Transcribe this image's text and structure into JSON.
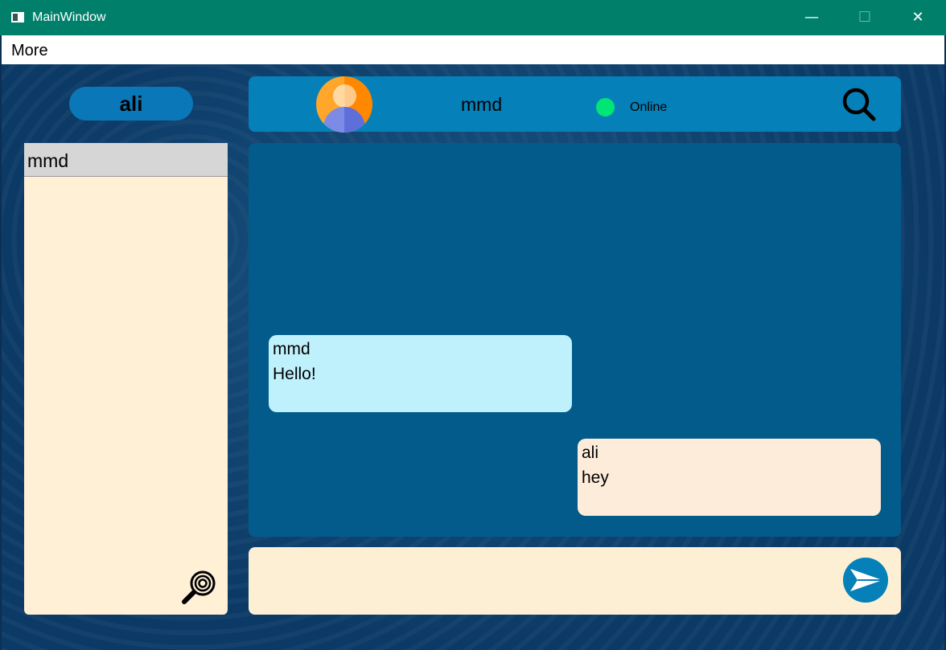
{
  "window": {
    "title": "MainWindow",
    "minimize_glyph": "—",
    "maximize_glyph": "☐",
    "close_glyph": "✕"
  },
  "menu": {
    "more_label": "More"
  },
  "current_user": {
    "name": "ali"
  },
  "chat_header": {
    "contact_name": "mmd",
    "status": "Online",
    "status_color": "#00e676"
  },
  "contacts": [
    {
      "name": "mmd"
    }
  ],
  "messages": [
    {
      "sender": "mmd",
      "text": "Hello!",
      "direction": "incoming",
      "color": "#bff1fc"
    },
    {
      "sender": "ali",
      "text": "hey",
      "direction": "outgoing",
      "color": "#fdecd9"
    }
  ],
  "composer": {
    "placeholder": ""
  },
  "icons": {
    "search": "search-icon",
    "find_contact": "magnifier-icon",
    "send": "send-icon",
    "avatar": "user-avatar-icon"
  },
  "colors": {
    "titlebar": "#00806b",
    "header": "#0680b8",
    "chat_bg": "#025b8a",
    "panel": "#fff0d6"
  }
}
